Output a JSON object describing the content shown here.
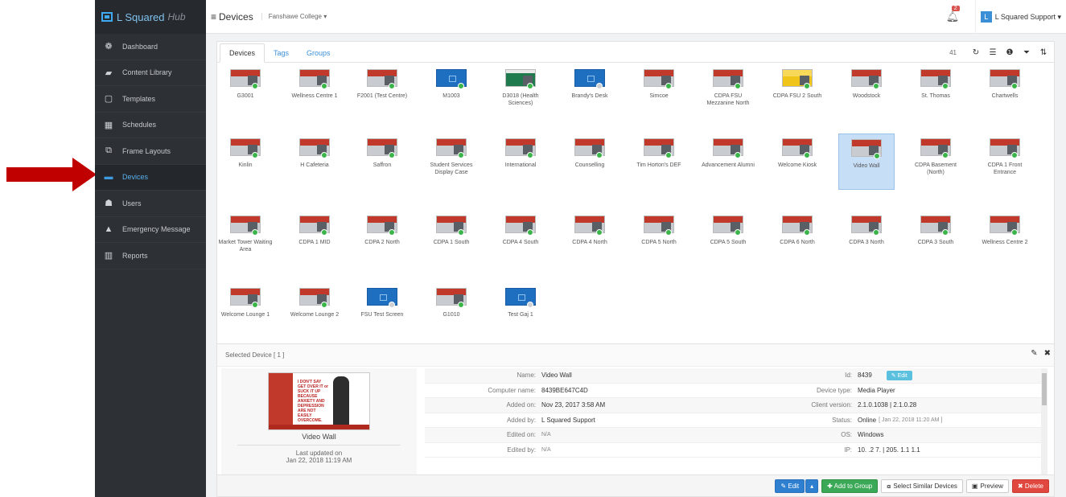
{
  "brand": {
    "name": "L Squared",
    "suffix": "Hub"
  },
  "sidebar": {
    "items": [
      {
        "label": "Dashboard",
        "icon": "palette-icon",
        "glyph": "❁"
      },
      {
        "label": "Content Library",
        "icon": "folder-icon",
        "glyph": "▰"
      },
      {
        "label": "Templates",
        "icon": "document-icon",
        "glyph": "▢"
      },
      {
        "label": "Schedules",
        "icon": "calendar-icon",
        "glyph": "▦"
      },
      {
        "label": "Frame Layouts",
        "icon": "frame-layout-icon",
        "glyph": "⧉"
      },
      {
        "label": "Devices",
        "icon": "monitor-icon",
        "glyph": "▬"
      },
      {
        "label": "Users",
        "icon": "user-icon",
        "glyph": "☗"
      },
      {
        "label": "Emergency Message",
        "icon": "warning-icon",
        "glyph": "▲"
      },
      {
        "label": "Reports",
        "icon": "bar-chart-icon",
        "glyph": "▥"
      }
    ],
    "active_index": 5
  },
  "topbar": {
    "menu_glyph": "≡",
    "title": "Devices",
    "org": "Fanshawe College ▾",
    "notification_count": "2",
    "user_initial": "L",
    "user_name": "L Squared Support ▾"
  },
  "devices_panel": {
    "tabs": [
      {
        "label": "Devices"
      },
      {
        "label": "Tags"
      },
      {
        "label": "Groups"
      }
    ],
    "count": "41",
    "tools": [
      {
        "name": "refresh-icon",
        "glyph": "↻"
      },
      {
        "name": "list-view-icon",
        "glyph": "☰"
      },
      {
        "name": "info-icon",
        "glyph": "❶"
      },
      {
        "name": "filter-icon",
        "glyph": "⏷"
      },
      {
        "name": "sort-icon",
        "glyph": "⇅"
      }
    ],
    "devices": [
      {
        "name": "G3001",
        "style": "red",
        "online": true
      },
      {
        "name": "Wellness Centre 1",
        "style": "red",
        "online": true
      },
      {
        "name": "F2001 (Test Centre)",
        "style": "red",
        "online": true
      },
      {
        "name": "M1003",
        "style": "blue",
        "online": true
      },
      {
        "name": "D3018 (Health Sciences)",
        "style": "green",
        "online": true
      },
      {
        "name": "Brandy's Desk",
        "style": "blue",
        "online": false
      },
      {
        "name": "Simcoe",
        "style": "red",
        "online": true
      },
      {
        "name": "CDPA FSU Mezzanine North",
        "style": "red",
        "online": true
      },
      {
        "name": "CDPA FSU 2 South",
        "style": "yellow",
        "online": true
      },
      {
        "name": "Woodstock",
        "style": "red",
        "online": true
      },
      {
        "name": "St. Thomas",
        "style": "red",
        "online": true
      },
      {
        "name": "Chartwells",
        "style": "red",
        "online": true
      },
      {
        "name": "Kinlin",
        "style": "red",
        "online": true
      },
      {
        "name": "H Cafeteria",
        "style": "red",
        "online": true
      },
      {
        "name": "Saffron",
        "style": "red",
        "online": true
      },
      {
        "name": "Student Services Display Case",
        "style": "red",
        "online": true
      },
      {
        "name": "International",
        "style": "red",
        "online": true
      },
      {
        "name": "Counselling",
        "style": "red",
        "online": true
      },
      {
        "name": "Tim Horton's DEF",
        "style": "red",
        "online": true
      },
      {
        "name": "Advancement Alumni",
        "style": "red",
        "online": true
      },
      {
        "name": "Welcome Kiosk",
        "style": "red",
        "online": true
      },
      {
        "name": "Video Wall",
        "style": "red",
        "online": true,
        "selected": true
      },
      {
        "name": "CDPA Basement (North)",
        "style": "red",
        "online": true
      },
      {
        "name": "CDPA 1 Front Entrance",
        "style": "red",
        "online": true
      },
      {
        "name": "Market Tower Waiting Area",
        "style": "red",
        "online": true
      },
      {
        "name": "CDPA 1 MID",
        "style": "red",
        "online": true
      },
      {
        "name": "CDPA 2 North",
        "style": "red",
        "online": true
      },
      {
        "name": "CDPA 1 South",
        "style": "red",
        "online": true
      },
      {
        "name": "CDPA 4 South",
        "style": "red",
        "online": true
      },
      {
        "name": "CDPA 4 North",
        "style": "red",
        "online": true
      },
      {
        "name": "CDPA 5 North",
        "style": "red",
        "online": true
      },
      {
        "name": "CDPA 5 South",
        "style": "red",
        "online": true
      },
      {
        "name": "CDPA 6 North",
        "style": "red",
        "online": true
      },
      {
        "name": "CDPA 3 North",
        "style": "red",
        "online": true
      },
      {
        "name": "CDPA 3 South",
        "style": "red",
        "online": true
      },
      {
        "name": "Wellness Centre 2",
        "style": "red",
        "online": true
      },
      {
        "name": "Welcome Lounge 1",
        "style": "red",
        "online": true
      },
      {
        "name": "Welcome Lounge 2",
        "style": "red",
        "online": true
      },
      {
        "name": "FSU Test Screen",
        "style": "blue",
        "online": false
      },
      {
        "name": "G1010",
        "style": "red",
        "online": true
      },
      {
        "name": "Test Gaj 1",
        "style": "blue",
        "online": false
      }
    ]
  },
  "selected_panel": {
    "title": "Selected Device [ 1 ]",
    "preview_name": "Video Wall",
    "preview_text": "I DON'T SAY GET OVER IT or SUCK IT UP BECAUSE ANXIETY AND DEPRESSION ARE NOT EASILY OVERCOME.",
    "updated_label": "Last updated on",
    "updated_value": "Jan 22, 2018 11:19 AM",
    "rows": [
      {
        "l1": "Name:",
        "v1": "Video Wall",
        "l2": "Id:",
        "v2": "8439",
        "edit": "✎ Edit"
      },
      {
        "l1": "Computer name:",
        "v1": "8439BE647C4D",
        "l2": "Device type:",
        "v2": "Media Player"
      },
      {
        "l1": "Added on:",
        "v1": "Nov 23, 2017 3:58 AM",
        "l2": "Client version:",
        "v2": "2.1.0.1038 | 2.1.0.28"
      },
      {
        "l1": "Added by:",
        "v1": "L Squared Support",
        "l2": "Status:",
        "v2": "Online",
        "v2sub": "[ Jan 22, 2018 11:20 AM ]"
      },
      {
        "l1": "Edited on:",
        "v1": "N/A",
        "l2": "OS:",
        "v2": "Windows"
      },
      {
        "l1": "Edited by:",
        "v1": "N/A",
        "l2": "IP:",
        "v2": "10. .2 7. | 205. 1.1 1.1"
      }
    ],
    "buttons": {
      "edit": "✎ Edit",
      "caret": "▴",
      "add_to_group": "✚ Add to Group",
      "select_similar": "Select Similar Devices",
      "preview": "Preview",
      "delete": "✖ Delete"
    }
  },
  "colors": {
    "accent": "#3a8fd6",
    "sidebar": "#2d3035",
    "annotation": "#c00000"
  }
}
